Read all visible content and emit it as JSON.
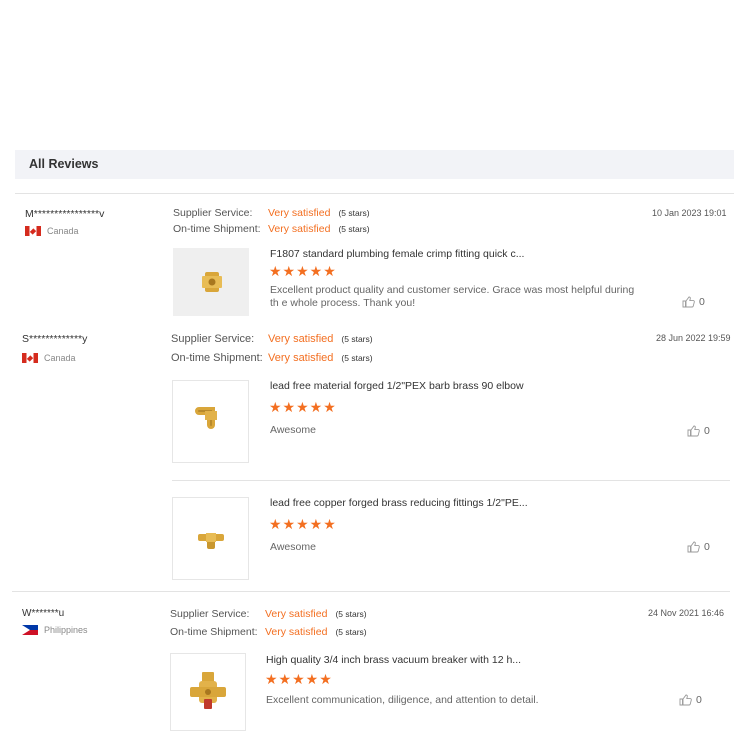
{
  "section": {
    "title": "All Reviews"
  },
  "reviews": [
    {
      "name": "M****************v",
      "country": "Canada",
      "date": "10 Jan 2023 19:01",
      "supplier_service_label": "Supplier Service:",
      "supplier_service_value": "Very satisfied",
      "supplier_service_stars": "(5 stars)",
      "shipment_label": "On-time Shipment:",
      "shipment_value": "Very satisfied",
      "shipment_stars": "(5 stars)",
      "products": [
        {
          "title": "F1807 standard plumbing female crimp fitting quick c...",
          "stars": "★★★★★",
          "text": "Excellent product quality and customer service. Grace was most helpful during th e whole process. Thank you!",
          "likes": "0"
        }
      ]
    },
    {
      "name": "S*************y",
      "country": "Canada",
      "date": "28 Jun 2022 19:59",
      "supplier_service_label": "Supplier Service:",
      "supplier_service_value": "Very satisfied",
      "supplier_service_stars": "(5 stars)",
      "shipment_label": "On-time Shipment:",
      "shipment_value": "Very satisfied",
      "shipment_stars": "(5 stars)",
      "products": [
        {
          "title": "lead free material forged 1/2\"PEX barb brass 90 elbow",
          "stars": "★★★★★",
          "text": "Awesome",
          "likes": "0"
        },
        {
          "title": "lead free copper forged brass reducing fittings 1/2\"PE...",
          "stars": "★★★★★",
          "text": "Awesome",
          "likes": "0"
        }
      ]
    },
    {
      "name": "W*******u",
      "country": "Philippines",
      "date": "24 Nov 2021 16:46",
      "supplier_service_label": "Supplier Service:",
      "supplier_service_value": "Very satisfied",
      "supplier_service_stars": "(5 stars)",
      "shipment_label": "On-time Shipment:",
      "shipment_value": "Very satisfied",
      "shipment_stars": "(5 stars)",
      "products": [
        {
          "title": "High quality 3/4 inch brass vacuum breaker with 12 h...",
          "stars": "★★★★★",
          "text": "Excellent communication, diligence, and attention to detail.",
          "likes": "0"
        }
      ]
    }
  ],
  "colors": {
    "accent": "#f36f21",
    "header_bg": "#f2f3f7",
    "brass": "#d9a63a"
  },
  "icons": {
    "like": "thumbs-up-icon",
    "flag_ca": "canada-flag-icon",
    "flag_ph": "philippines-flag-icon"
  }
}
